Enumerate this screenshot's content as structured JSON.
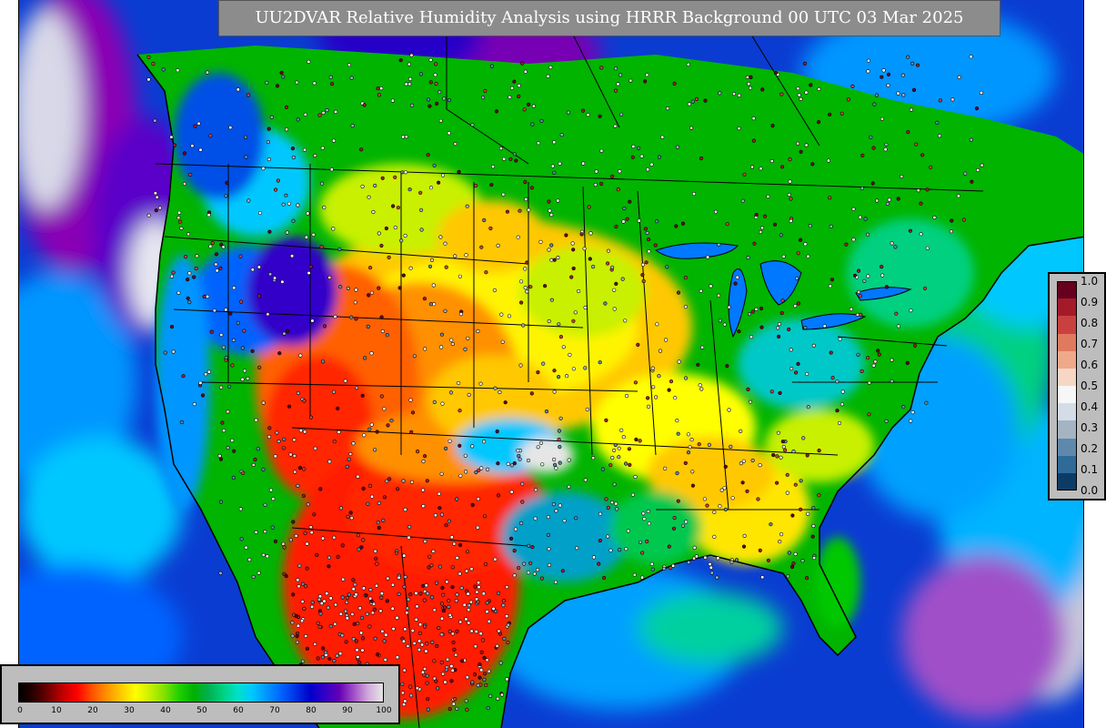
{
  "title": "UU2DVAR Relative Humidity Analysis using HRRR Background 00 UTC 03 Mar 2025",
  "rh_colorbar": {
    "ticks": [
      "0",
      "10",
      "20",
      "30",
      "40",
      "50",
      "60",
      "70",
      "80",
      "90",
      "100"
    ]
  },
  "fraction_colorbar": {
    "ticks": [
      "1.0",
      "0.9",
      "0.8",
      "0.7",
      "0.6",
      "0.5",
      "0.4",
      "0.3",
      "0.2",
      "0.1",
      "0.0"
    ],
    "colors": [
      "#67001f",
      "#a51a29",
      "#c9413e",
      "#e07a5f",
      "#efa98a",
      "#f6d6c4",
      "#f7f7f7",
      "#d4dde6",
      "#a5b4c3",
      "#5e89ad",
      "#2f6a99",
      "#0c3c66"
    ]
  },
  "colors": {
    "ocean": "#0a3cd2",
    "land_dry": "#ff3000",
    "land_moist": "#00c800",
    "title_bg": "#8c8c8c",
    "legend_bg": "#bdbdbd"
  }
}
